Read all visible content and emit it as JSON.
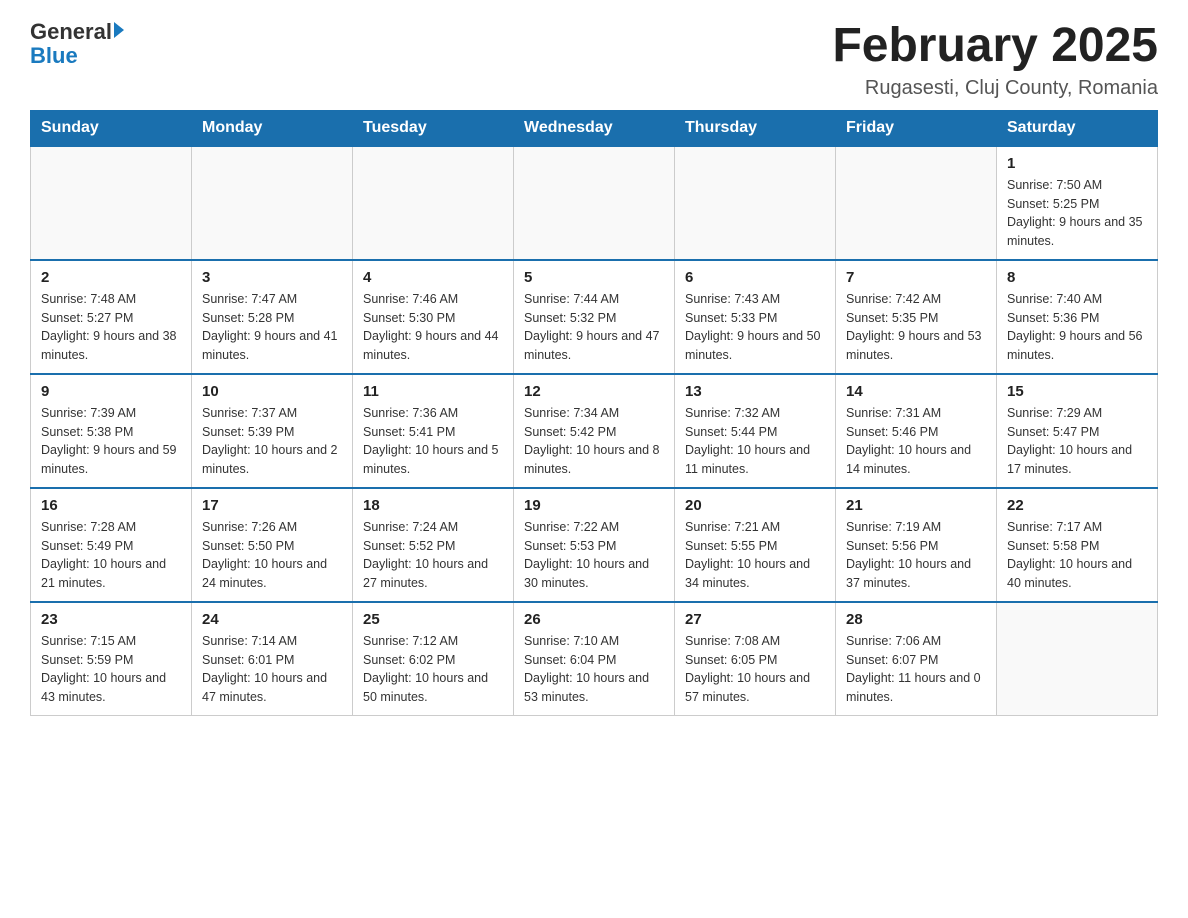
{
  "header": {
    "logo_general": "General",
    "logo_blue": "Blue",
    "title": "February 2025",
    "subtitle": "Rugasesti, Cluj County, Romania"
  },
  "days_of_week": [
    "Sunday",
    "Monday",
    "Tuesday",
    "Wednesday",
    "Thursday",
    "Friday",
    "Saturday"
  ],
  "weeks": [
    [
      {
        "day": "",
        "info": ""
      },
      {
        "day": "",
        "info": ""
      },
      {
        "day": "",
        "info": ""
      },
      {
        "day": "",
        "info": ""
      },
      {
        "day": "",
        "info": ""
      },
      {
        "day": "",
        "info": ""
      },
      {
        "day": "1",
        "info": "Sunrise: 7:50 AM\nSunset: 5:25 PM\nDaylight: 9 hours and 35 minutes."
      }
    ],
    [
      {
        "day": "2",
        "info": "Sunrise: 7:48 AM\nSunset: 5:27 PM\nDaylight: 9 hours and 38 minutes."
      },
      {
        "day": "3",
        "info": "Sunrise: 7:47 AM\nSunset: 5:28 PM\nDaylight: 9 hours and 41 minutes."
      },
      {
        "day": "4",
        "info": "Sunrise: 7:46 AM\nSunset: 5:30 PM\nDaylight: 9 hours and 44 minutes."
      },
      {
        "day": "5",
        "info": "Sunrise: 7:44 AM\nSunset: 5:32 PM\nDaylight: 9 hours and 47 minutes."
      },
      {
        "day": "6",
        "info": "Sunrise: 7:43 AM\nSunset: 5:33 PM\nDaylight: 9 hours and 50 minutes."
      },
      {
        "day": "7",
        "info": "Sunrise: 7:42 AM\nSunset: 5:35 PM\nDaylight: 9 hours and 53 minutes."
      },
      {
        "day": "8",
        "info": "Sunrise: 7:40 AM\nSunset: 5:36 PM\nDaylight: 9 hours and 56 minutes."
      }
    ],
    [
      {
        "day": "9",
        "info": "Sunrise: 7:39 AM\nSunset: 5:38 PM\nDaylight: 9 hours and 59 minutes."
      },
      {
        "day": "10",
        "info": "Sunrise: 7:37 AM\nSunset: 5:39 PM\nDaylight: 10 hours and 2 minutes."
      },
      {
        "day": "11",
        "info": "Sunrise: 7:36 AM\nSunset: 5:41 PM\nDaylight: 10 hours and 5 minutes."
      },
      {
        "day": "12",
        "info": "Sunrise: 7:34 AM\nSunset: 5:42 PM\nDaylight: 10 hours and 8 minutes."
      },
      {
        "day": "13",
        "info": "Sunrise: 7:32 AM\nSunset: 5:44 PM\nDaylight: 10 hours and 11 minutes."
      },
      {
        "day": "14",
        "info": "Sunrise: 7:31 AM\nSunset: 5:46 PM\nDaylight: 10 hours and 14 minutes."
      },
      {
        "day": "15",
        "info": "Sunrise: 7:29 AM\nSunset: 5:47 PM\nDaylight: 10 hours and 17 minutes."
      }
    ],
    [
      {
        "day": "16",
        "info": "Sunrise: 7:28 AM\nSunset: 5:49 PM\nDaylight: 10 hours and 21 minutes."
      },
      {
        "day": "17",
        "info": "Sunrise: 7:26 AM\nSunset: 5:50 PM\nDaylight: 10 hours and 24 minutes."
      },
      {
        "day": "18",
        "info": "Sunrise: 7:24 AM\nSunset: 5:52 PM\nDaylight: 10 hours and 27 minutes."
      },
      {
        "day": "19",
        "info": "Sunrise: 7:22 AM\nSunset: 5:53 PM\nDaylight: 10 hours and 30 minutes."
      },
      {
        "day": "20",
        "info": "Sunrise: 7:21 AM\nSunset: 5:55 PM\nDaylight: 10 hours and 34 minutes."
      },
      {
        "day": "21",
        "info": "Sunrise: 7:19 AM\nSunset: 5:56 PM\nDaylight: 10 hours and 37 minutes."
      },
      {
        "day": "22",
        "info": "Sunrise: 7:17 AM\nSunset: 5:58 PM\nDaylight: 10 hours and 40 minutes."
      }
    ],
    [
      {
        "day": "23",
        "info": "Sunrise: 7:15 AM\nSunset: 5:59 PM\nDaylight: 10 hours and 43 minutes."
      },
      {
        "day": "24",
        "info": "Sunrise: 7:14 AM\nSunset: 6:01 PM\nDaylight: 10 hours and 47 minutes."
      },
      {
        "day": "25",
        "info": "Sunrise: 7:12 AM\nSunset: 6:02 PM\nDaylight: 10 hours and 50 minutes."
      },
      {
        "day": "26",
        "info": "Sunrise: 7:10 AM\nSunset: 6:04 PM\nDaylight: 10 hours and 53 minutes."
      },
      {
        "day": "27",
        "info": "Sunrise: 7:08 AM\nSunset: 6:05 PM\nDaylight: 10 hours and 57 minutes."
      },
      {
        "day": "28",
        "info": "Sunrise: 7:06 AM\nSunset: 6:07 PM\nDaylight: 11 hours and 0 minutes."
      },
      {
        "day": "",
        "info": ""
      }
    ]
  ]
}
